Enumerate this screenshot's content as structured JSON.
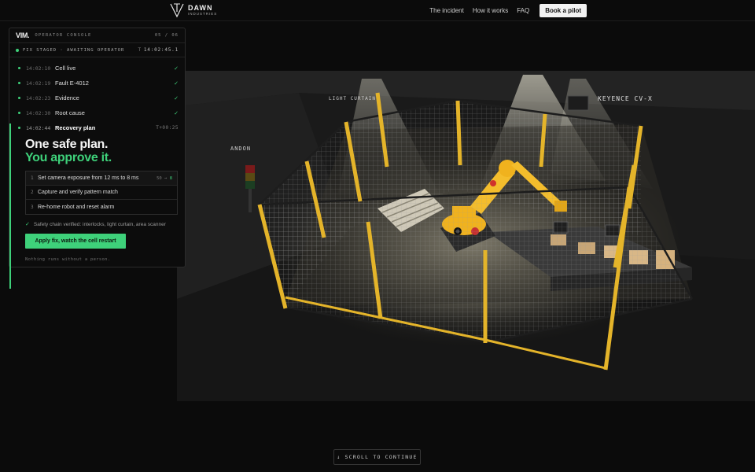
{
  "brand": {
    "name": "DAWN",
    "sub": "INDUSTRIES"
  },
  "nav": {
    "items": [
      "The incident",
      "How it works",
      "FAQ"
    ],
    "cta": "Book a pilot"
  },
  "scene_labels": {
    "light_curtain": "LIGHT CURTAIN",
    "keyence": "KEYENCE CV-X",
    "andon": "ANDON"
  },
  "console": {
    "brand": "VIM.",
    "title": "OPERATOR CONSOLE",
    "page": "05 / 06",
    "status": {
      "text": "FIX STAGED · AWAITING OPERATOR",
      "time_prefix": "T",
      "time": "14:02:45.1"
    },
    "steps": [
      {
        "time": "14:02:10",
        "label": "Cell live",
        "mark": "✓"
      },
      {
        "time": "14:02:19",
        "label": "Fault E-4012",
        "mark": "✓"
      },
      {
        "time": "14:02:23",
        "label": "Evidence",
        "mark": "✓"
      },
      {
        "time": "14:02:30",
        "label": "Root cause",
        "mark": "✓"
      },
      {
        "time": "14:02:44",
        "label": "Recovery plan",
        "elapsed": "T+00:25"
      }
    ],
    "headline": {
      "line1": "One safe plan.",
      "line2": "You approve it."
    },
    "plan": [
      {
        "num": "1",
        "label": "Set camera exposure from 12 ms to 8 ms",
        "meta_a": "50",
        "meta_sep": " → ",
        "meta_b": "8"
      },
      {
        "num": "2",
        "label": "Capture and verify pattern match"
      },
      {
        "num": "3",
        "label": "Re-home robot and reset alarm"
      }
    ],
    "safety": "Safety chain verified: interlocks, light curtain, area scanner",
    "apply_button": "Apply fix, watch the cell restart",
    "footnote": "Nothing runs without a person."
  },
  "scroll": {
    "arrow": "↓",
    "label": "SCROLL TO CONTINUE"
  },
  "colors": {
    "accent": "#3ed17a",
    "fence": "#e4b42a",
    "robot": "#f0b21e"
  }
}
